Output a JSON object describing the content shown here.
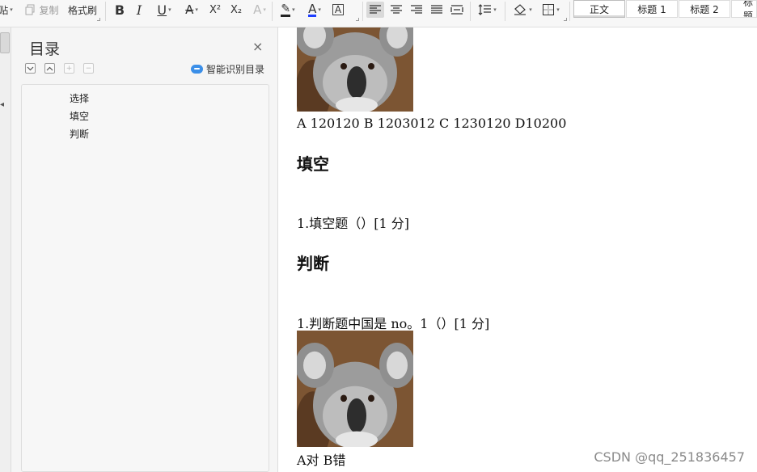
{
  "toolbar": {
    "paste_label": "贴",
    "copy_label": "复制",
    "format_painter_label": "格式刷",
    "bold_glyph": "B",
    "italic_glyph": "I",
    "underline_glyph": "U",
    "strike_glyph": "A",
    "superscript_glyph": "X²",
    "subscript_glyph": "X₂",
    "effect_glyph": "A",
    "highlight_glyph": "✎",
    "font_color_glyph": "A",
    "charborder_glyph": "A",
    "styles": [
      {
        "label": "正文",
        "active": true
      },
      {
        "label": "标题 1",
        "active": false
      },
      {
        "label": "标题 2",
        "active": false
      },
      {
        "label": "标题",
        "active": false
      }
    ],
    "colors": {
      "font_color_bar": "#1f3fff",
      "align_active_bg": "#d9d9d9"
    }
  },
  "toc": {
    "title": "目录",
    "close_glyph": "×",
    "smart_label": "智能识别目录",
    "items": [
      "选择",
      "填空",
      "判断"
    ]
  },
  "document": {
    "options_line_1": "A 120120 B 1203012 C 1230120 D10200",
    "heading_fill": "填空",
    "question_fill": "1.填空题（）[1 分]",
    "heading_judge": "判断",
    "question_judge": "1.判断题中国是 no。1（）[1 分]",
    "options_line_2": "A对 B错"
  },
  "watermark": "CSDN @qq_251836457"
}
